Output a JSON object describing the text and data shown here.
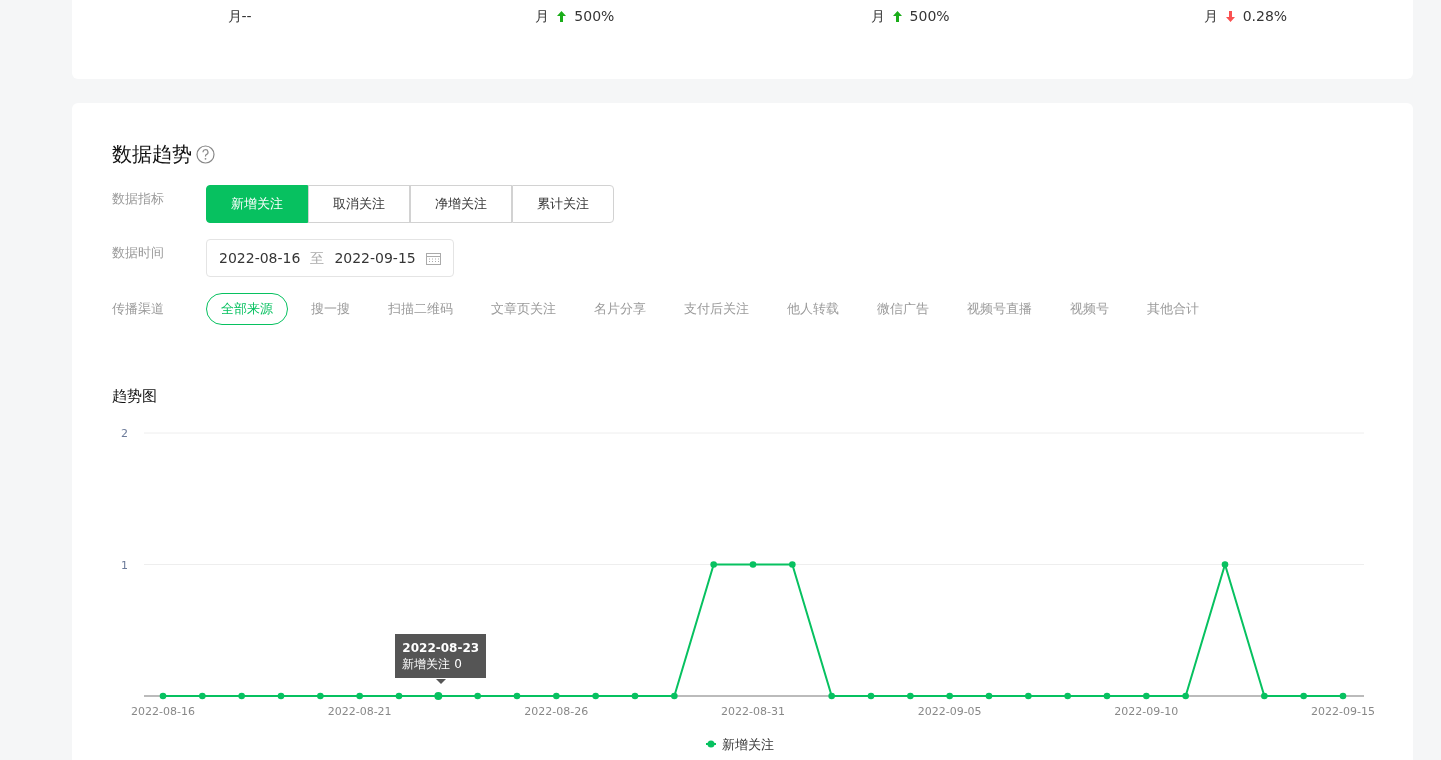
{
  "summary": [
    {
      "label": "月",
      "change": "--",
      "kind": "flat"
    },
    {
      "label": "月",
      "change": "500%",
      "kind": "up"
    },
    {
      "label": "月",
      "change": "500%",
      "kind": "up"
    },
    {
      "label": "月",
      "change": "0.28%",
      "kind": "down"
    }
  ],
  "trend": {
    "title": "数据趋势",
    "metric_label": "数据指标",
    "metrics": [
      {
        "label": "新增关注",
        "selected": true
      },
      {
        "label": "取消关注",
        "selected": false
      },
      {
        "label": "净增关注",
        "selected": false
      },
      {
        "label": "累计关注",
        "selected": false
      }
    ],
    "time_label": "数据时间",
    "date_range": {
      "start": "2022-08-16",
      "separator": "至",
      "end": "2022-09-15"
    },
    "channel_label": "传播渠道",
    "channels": [
      {
        "label": "全部来源",
        "selected": true
      },
      {
        "label": "搜一搜",
        "selected": false
      },
      {
        "label": "扫描二维码",
        "selected": false
      },
      {
        "label": "文章页关注",
        "selected": false
      },
      {
        "label": "名片分享",
        "selected": false
      },
      {
        "label": "支付后关注",
        "selected": false
      },
      {
        "label": "他人转载",
        "selected": false
      },
      {
        "label": "微信广告",
        "selected": false
      },
      {
        "label": "视频号直播",
        "selected": false
      },
      {
        "label": "视频号",
        "selected": false
      },
      {
        "label": "其他合计",
        "selected": false
      }
    ],
    "chart_title": "趋势图",
    "chart_data": {
      "type": "line",
      "categories": [
        "2022-08-16",
        null,
        null,
        null,
        null,
        "2022-08-21",
        null,
        null,
        null,
        null,
        "2022-08-26",
        null,
        null,
        null,
        null,
        "2022-08-31",
        null,
        null,
        null,
        null,
        "2022-09-05",
        null,
        null,
        null,
        null,
        "2022-09-10",
        null,
        null,
        null,
        null,
        "2022-09-15"
      ],
      "series": [
        {
          "name": "新增关注",
          "color": "#07c160",
          "marker": "circle",
          "values": [
            0,
            0,
            0,
            0,
            0,
            0,
            0,
            0,
            0,
            0,
            0,
            0,
            0,
            0,
            1,
            1,
            1,
            0,
            0,
            0,
            0,
            0,
            0,
            0,
            0,
            0,
            0,
            1,
            0,
            0,
            0
          ]
        }
      ],
      "ylim": [
        0,
        2
      ],
      "yticks": [
        1,
        2
      ]
    },
    "tooltip": {
      "title": "2022-08-23",
      "text": "新增关注 0"
    }
  }
}
